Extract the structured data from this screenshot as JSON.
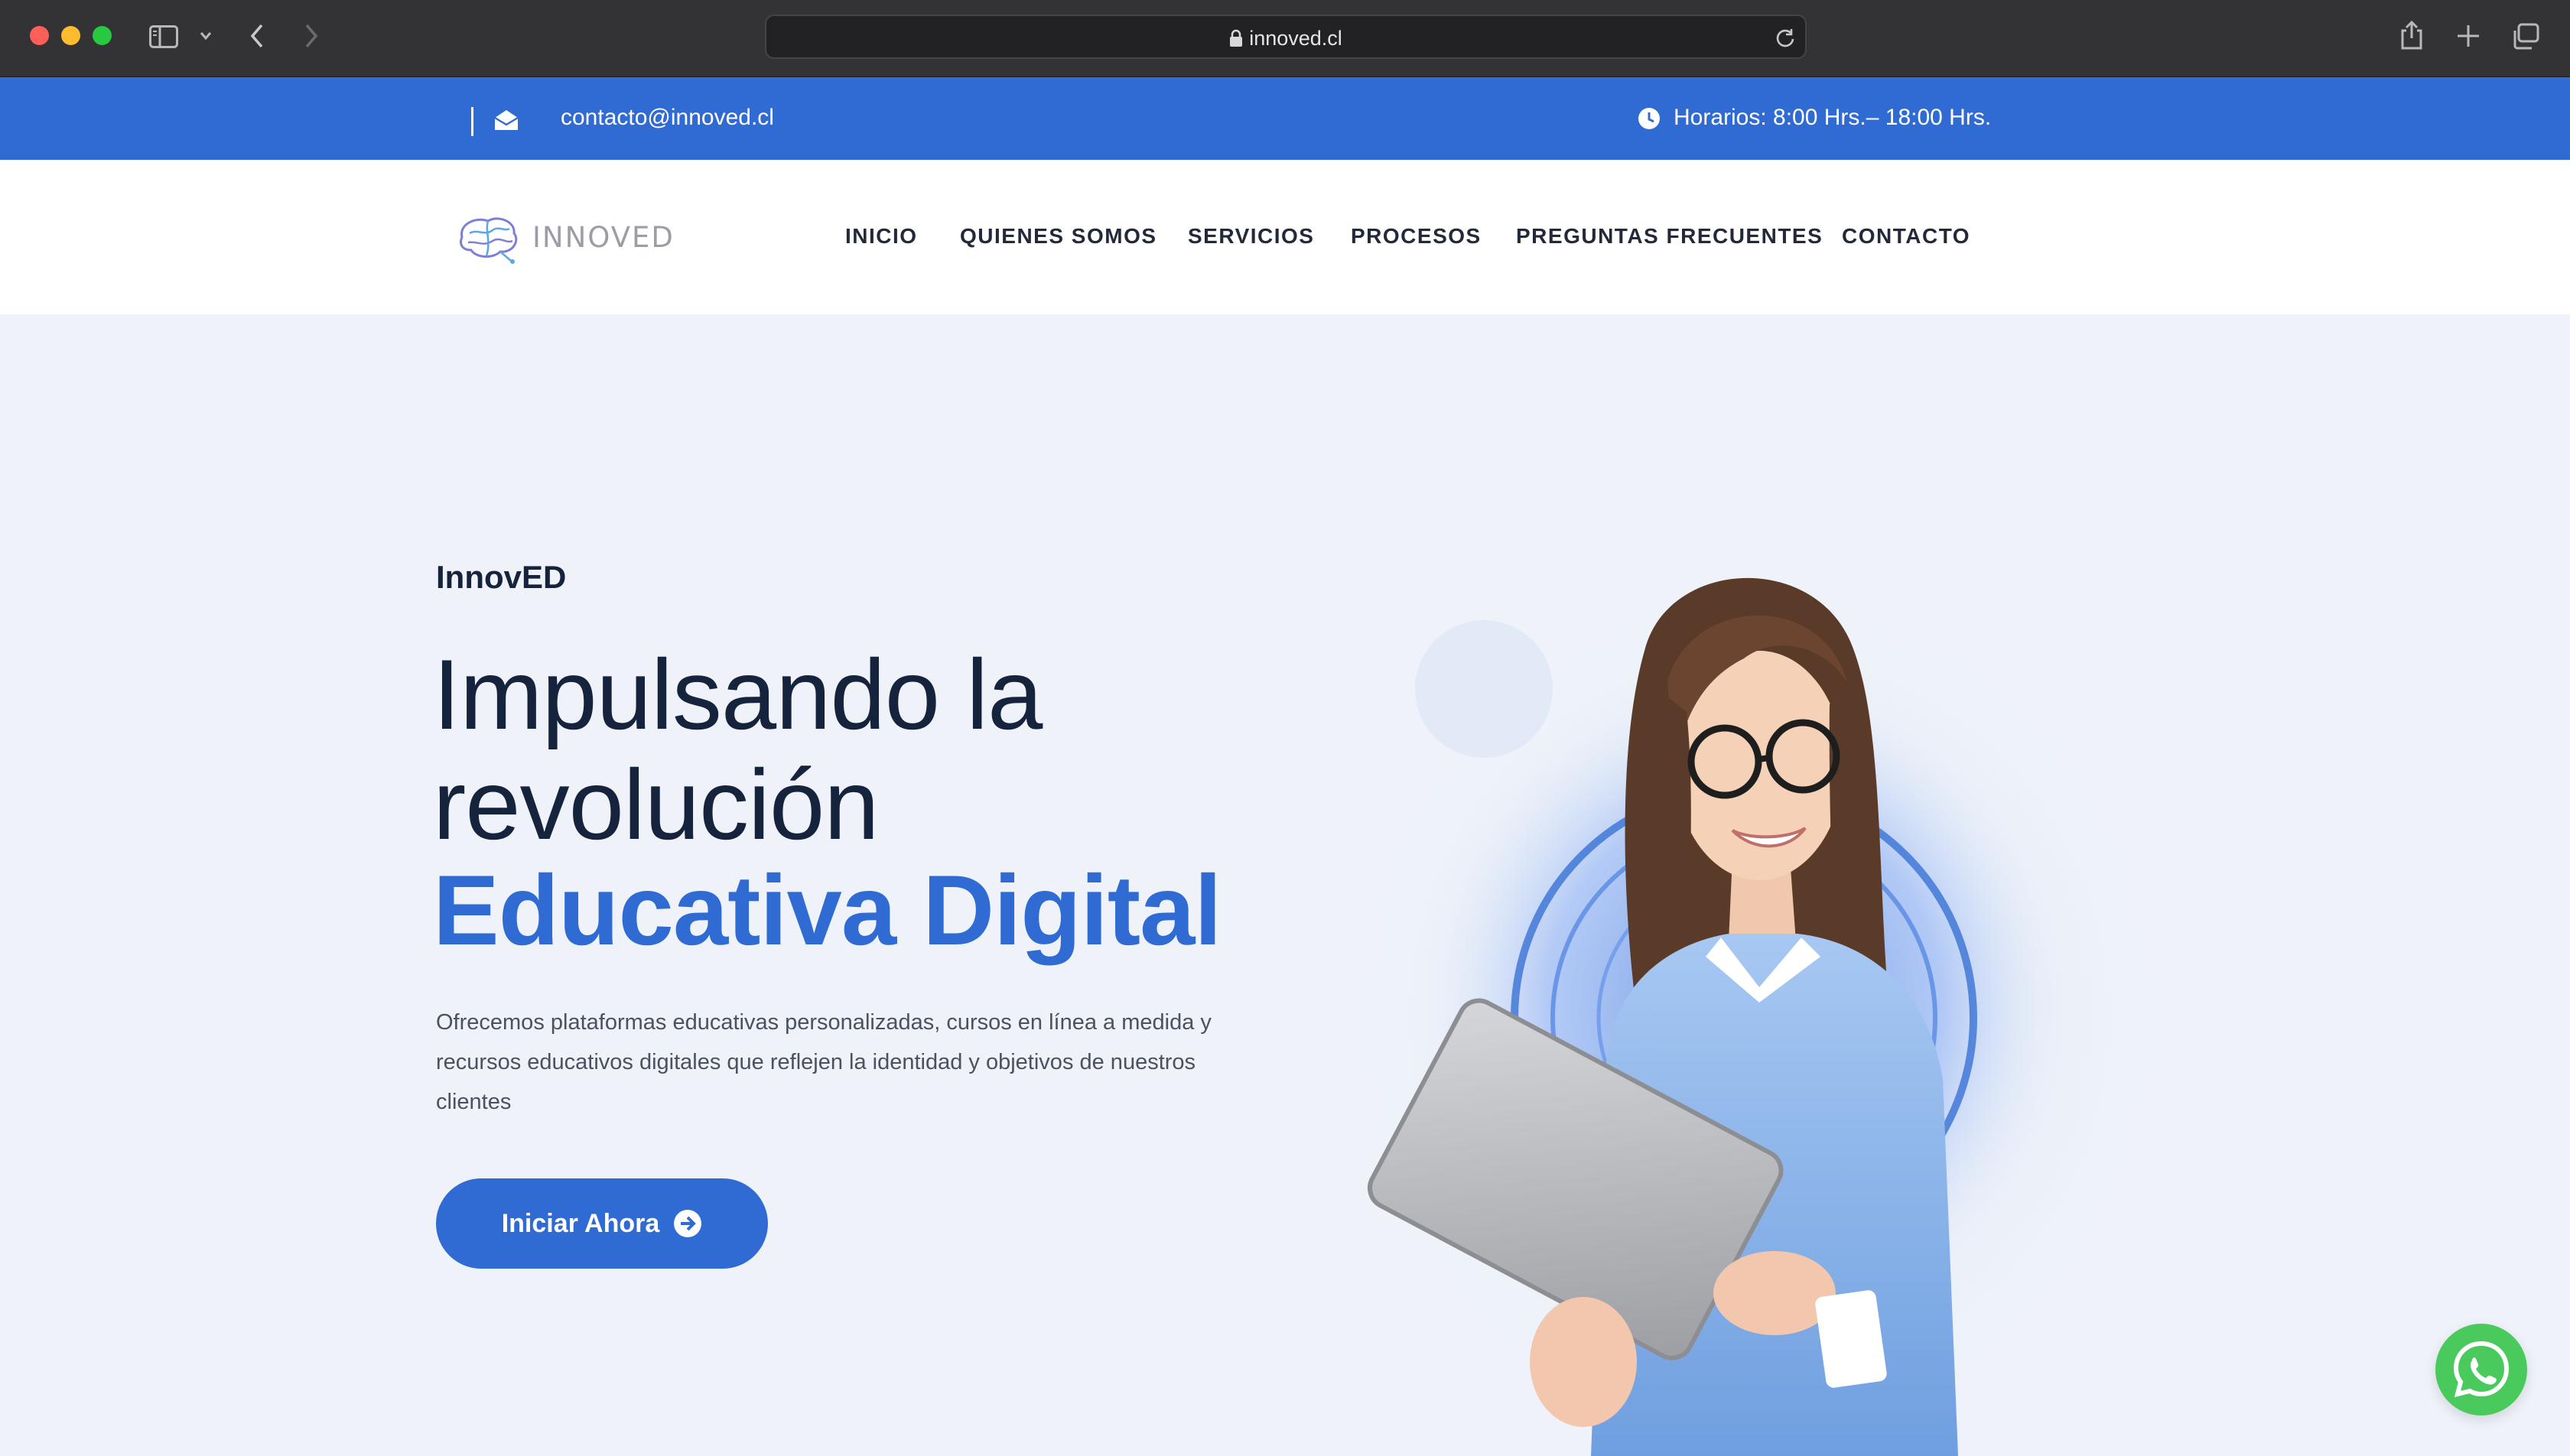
{
  "browser": {
    "url": "innoved.cl",
    "icons": [
      "sidebar-icon",
      "chevron-down-icon",
      "back-icon",
      "forward-icon",
      "lock-icon",
      "reload-icon",
      "share-icon",
      "new-tab-icon",
      "tabs-overview-icon"
    ]
  },
  "topbar": {
    "email": "contacto@innoved.cl",
    "hours": "Horarios: 8:00 Hrs.– 18:00 Hrs.",
    "background": "#2f6bd3"
  },
  "header": {
    "logo_text": "INNOVED",
    "nav": [
      "INICIO",
      "QUIENES SOMOS",
      "SERVICIOS",
      "PROCESOS",
      "PREGUNTAS FRECUENTES",
      "CONTACTO"
    ]
  },
  "hero": {
    "kicker": "InnovED",
    "title_line1": "Impulsando la",
    "title_line2": "revolución",
    "title_highlight": "Educativa Digital",
    "description": "Ofrecemos plataformas educativas personalizadas, cursos en línea a medida y recursos educativos digitales que reflejen la identidad y objetivos de nuestros clientes",
    "cta_label": "Iniciar Ahora",
    "accent": "#2f6bd3"
  },
  "floating": {
    "whatsapp_icon": "whatsapp-icon",
    "color": "#4ac95d"
  }
}
